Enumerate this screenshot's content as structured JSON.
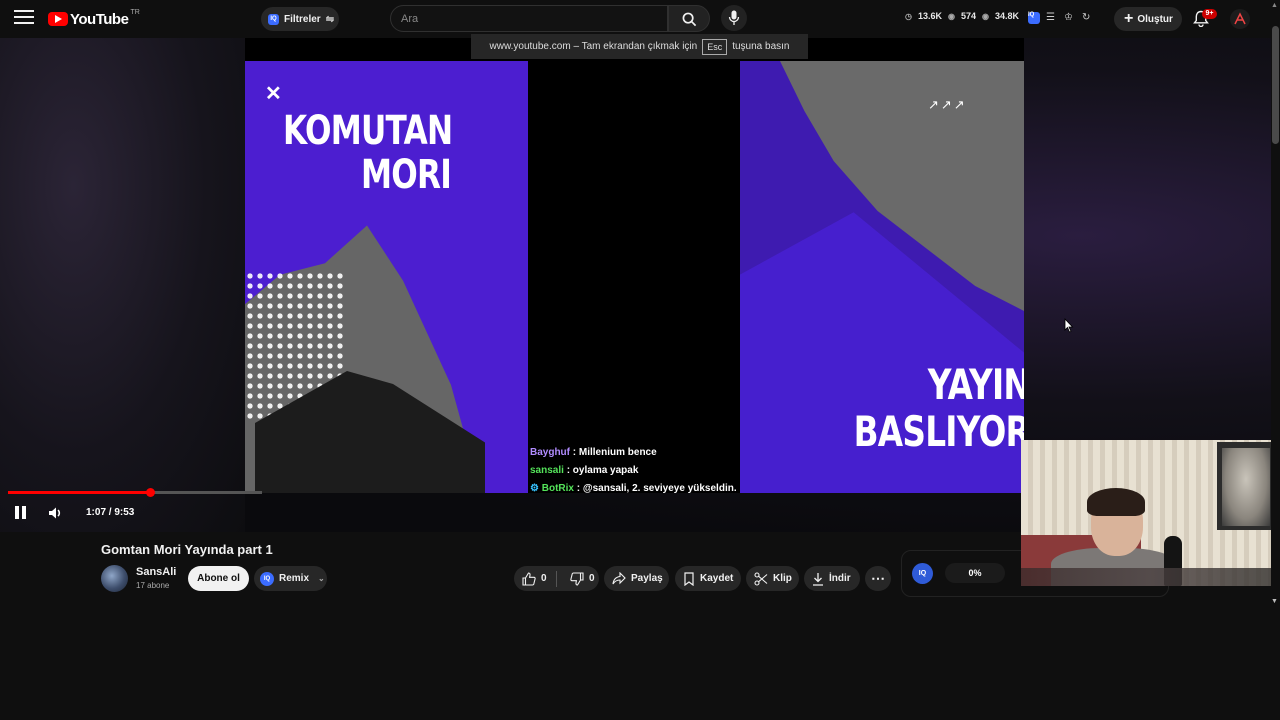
{
  "header": {
    "logo_text": "YouTube",
    "logo_country": "TR",
    "filters_label": "Filtreler",
    "search_placeholder": "Ara",
    "stats": [
      "13.6K",
      "574",
      "34.8K"
    ],
    "create_label": "Oluştur",
    "notifications_badge": "9+"
  },
  "player": {
    "fullscreen_toast_prefix": "www.youtube.com – Tam ekrandan çıkmak için",
    "fullscreen_toast_key": "Esc",
    "fullscreen_toast_suffix": "tuşuna basın",
    "overlay_title_line1": "KOMUTAN",
    "overlay_title_line2": "MORI",
    "overlay_banner_line1": "YAYIN",
    "overlay_banner_line2": "BASLIYOR",
    "chat": [
      {
        "user": "Bayghuf",
        "message": ": Millenium bence"
      },
      {
        "user": "sansali",
        "message": ": oylama yapak"
      },
      {
        "user": "BotRix",
        "message": ": @sansali, 2. seviyeye yükseldin."
      }
    ],
    "time_display": "1:07 / 9:53",
    "progress_fraction": 0.113
  },
  "video": {
    "title": "Gomtan Mori Yayında part 1",
    "channel_name": "SansAli",
    "subscriber_count": "17 abone",
    "subscribe_label": "Abone ol",
    "remix_label": "Remix",
    "like_count": "0",
    "dislike_count": "0",
    "share_label": "Paylaş",
    "save_label": "Kaydet",
    "clip_label": "Klip",
    "download_label": "İndir",
    "extension_percent": "0%"
  },
  "colors": {
    "background": "#0f0f0f",
    "accent_red": "#ff0000",
    "overlay_purple": "#4c1ed0"
  }
}
